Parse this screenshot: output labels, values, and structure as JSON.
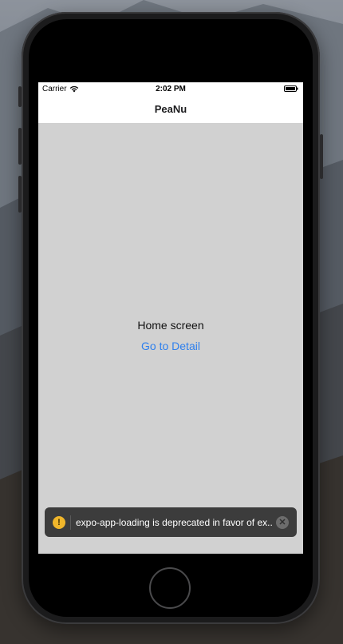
{
  "status_bar": {
    "carrier": "Carrier",
    "time": "2:02 PM",
    "wifi_icon": "wifi-icon",
    "battery_icon": "battery-icon"
  },
  "nav_bar": {
    "title": "PeaNu"
  },
  "home": {
    "text": "Home screen",
    "link": "Go to Detail"
  },
  "toast": {
    "icon": "warning-icon",
    "message": "expo-app-loading is deprecated in favor of ex...",
    "close_icon": "close-icon"
  },
  "colors": {
    "link": "#2f80ed",
    "screen_bg": "#d1d1d1",
    "toast_bg": "#3c3c3c",
    "warning": "#f0b62b"
  }
}
